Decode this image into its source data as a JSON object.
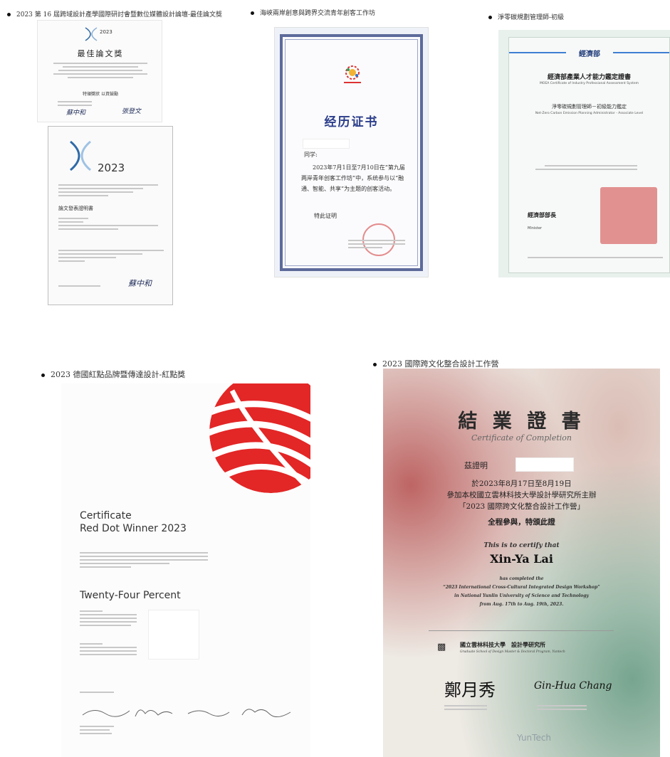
{
  "captions": [
    "2023 第 16 屆跨域設計產學國際研討會暨數位媒體設計論壇-最佳論文獎",
    "海峽兩岸創意與跨界交流青年創客工作坊",
    "淨零碳規劃管理師-初級",
    "2023 德國紅點品牌暨傳達設計-紅點獎",
    "2023 國際跨文化整合設計工作營"
  ],
  "best_paper": {
    "logo_year": "2023",
    "title": "最佳論文獎",
    "sub": "特頒獎狀 以資鼓勵",
    "sig1": "蘇中和",
    "sig2": "張登文"
  },
  "paper_cert": {
    "year": "2023",
    "heading": "論文發表證明書",
    "sig": "蘇中和"
  },
  "experience": {
    "title": "经历证书",
    "greeting": "同学:",
    "body": "2023年7月1日至7月10日在“第九届两岸青年创客工作坊”中，系统参与以“融通、智能、共享”为主题的创客活动。",
    "closing": "特此证明"
  },
  "moea": {
    "ministry": "經濟部",
    "title": "經濟部產業人才能力鑑定證書",
    "title_en": "MOEA Certificate of Industry Professional Assessment System",
    "role": "淨零碳規劃管理師－初級能力鑑定",
    "role_en": "Net-Zero Carbon Emission Planning Administrator - Associate Level",
    "minister": "經濟部部長",
    "minister_en": "Minister"
  },
  "reddot": {
    "line1": "Certificate",
    "line2": "Red Dot Winner 2023",
    "winner": "Twenty-Four Percent"
  },
  "completion": {
    "title": "結 業 證 書",
    "subtitle": "Certificate of Completion",
    "cert_label": "茲證明",
    "line1": "於2023年8月17日至8月19日",
    "line2": "參加本校國立雲林科技大學設計學研究所主辦",
    "line3": "「2023 國際跨文化整合設計工作營」",
    "line4": "全程參與，特頒此證",
    "en1": "This is to certify that",
    "name": "Xin-Ya Lai",
    "en2": "has completed the",
    "en3": "“2023 International Cross-Cultural Integrated Design Workshop”",
    "en4": "in National Yunlin University of Science and Technology",
    "en5": "from Aug. 17th to Aug. 19th, 2023.",
    "school": "國立雲林科技大學　設計學研究所",
    "school_en": "Graduate School of Design Master & Doctoral Program, Yuntech",
    "sig1": "鄭月秀",
    "sig2": "Gin-Hua Chang",
    "footer": "YunTech"
  }
}
